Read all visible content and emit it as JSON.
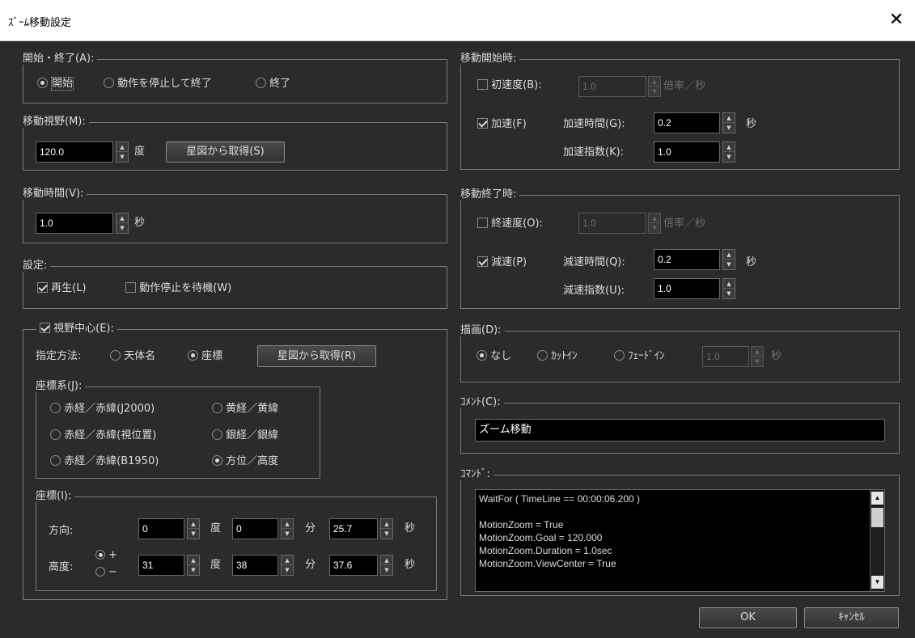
{
  "window": {
    "title": "ｽﾞｰﾑ移動設定",
    "close": "✕"
  },
  "start_end": {
    "caption": "開始・終了(A):",
    "options": [
      {
        "label": "開始",
        "selected": true
      },
      {
        "label": "動作を停止して終了",
        "selected": false
      },
      {
        "label": "終了",
        "selected": false
      }
    ]
  },
  "fov": {
    "caption": "移動視野(M):",
    "value": "120.0",
    "unit": "度",
    "button": "星図から取得(S)"
  },
  "move_time": {
    "caption": "移動時間(V):",
    "value": "1.0",
    "unit": "秒"
  },
  "settings": {
    "caption": "設定:",
    "play": {
      "label": "再生(L)",
      "checked": true
    },
    "wait": {
      "label": "動作停止を待機(W)",
      "checked": false
    }
  },
  "view_center": {
    "label": "視野中心(E):",
    "checked": true,
    "method_label": "指定方法:",
    "methods": [
      {
        "label": "天体名",
        "selected": false
      },
      {
        "label": "座標",
        "selected": true
      }
    ],
    "button": "星図から取得(R)",
    "coord_system": {
      "caption": "座標系(J):",
      "options": [
        {
          "label": "赤経／赤緯(J2000)",
          "selected": false
        },
        {
          "label": "黄経／黄緯",
          "selected": false
        },
        {
          "label": "赤経／赤緯(視位置)",
          "selected": false
        },
        {
          "label": "銀経／銀緯",
          "selected": false
        },
        {
          "label": "赤経／赤緯(B1950)",
          "selected": false
        },
        {
          "label": "方位／高度",
          "selected": true
        }
      ]
    },
    "coords": {
      "caption": "座標(I):",
      "dir": {
        "label": "方向:",
        "deg": "0",
        "min": "0",
        "sec": "25.7"
      },
      "alt": {
        "label": "高度:",
        "plus": "+",
        "minus": "−",
        "plus_selected": true,
        "deg": "31",
        "min": "38",
        "sec": "37.6"
      },
      "unit_deg": "度",
      "unit_min": "分",
      "unit_sec": "秒"
    }
  },
  "move_start": {
    "caption": "移動開始時:",
    "init_speed": {
      "label": "初速度(B):",
      "checked": false,
      "value": "1.0",
      "unit": "倍率／秒"
    },
    "accel": {
      "label": "加速(F)",
      "checked": true
    },
    "accel_time": {
      "label": "加速時間(G):",
      "value": "0.2",
      "unit": "秒"
    },
    "accel_index": {
      "label": "加速指数(K):",
      "value": "1.0"
    }
  },
  "move_end": {
    "caption": "移動終了時:",
    "end_speed": {
      "label": "終速度(O):",
      "checked": false,
      "value": "1.0",
      "unit": "倍率／秒"
    },
    "decel": {
      "label": "減速(P)",
      "checked": true
    },
    "decel_time": {
      "label": "減速時間(Q):",
      "value": "0.2",
      "unit": "秒"
    },
    "decel_index": {
      "label": "減速指数(U):",
      "value": "1.0"
    }
  },
  "draw": {
    "caption": "描画(D):",
    "options": [
      {
        "label": "なし",
        "selected": true
      },
      {
        "label": "ｶｯﾄｲﾝ",
        "selected": false
      },
      {
        "label": "ﾌｪｰﾄﾞｲﾝ",
        "selected": false
      }
    ],
    "value": "1.0",
    "unit": "秒"
  },
  "comment": {
    "caption": "ｺﾒﾝﾄ(C):",
    "value": "ズーム移動"
  },
  "command": {
    "caption": "ｺﾏﾝﾄﾞ:",
    "lines": [
      "WaitFor ( TimeLine ==  00:00:06.200 )",
      "",
      "MotionZoom = True",
      "MotionZoom.Goal = 120.000",
      "MotionZoom.Duration = 1.0sec",
      "MotionZoom.ViewCenter = True"
    ]
  },
  "buttons": {
    "ok": "OK",
    "cancel": "ｷｬﾝｾﾙ"
  }
}
